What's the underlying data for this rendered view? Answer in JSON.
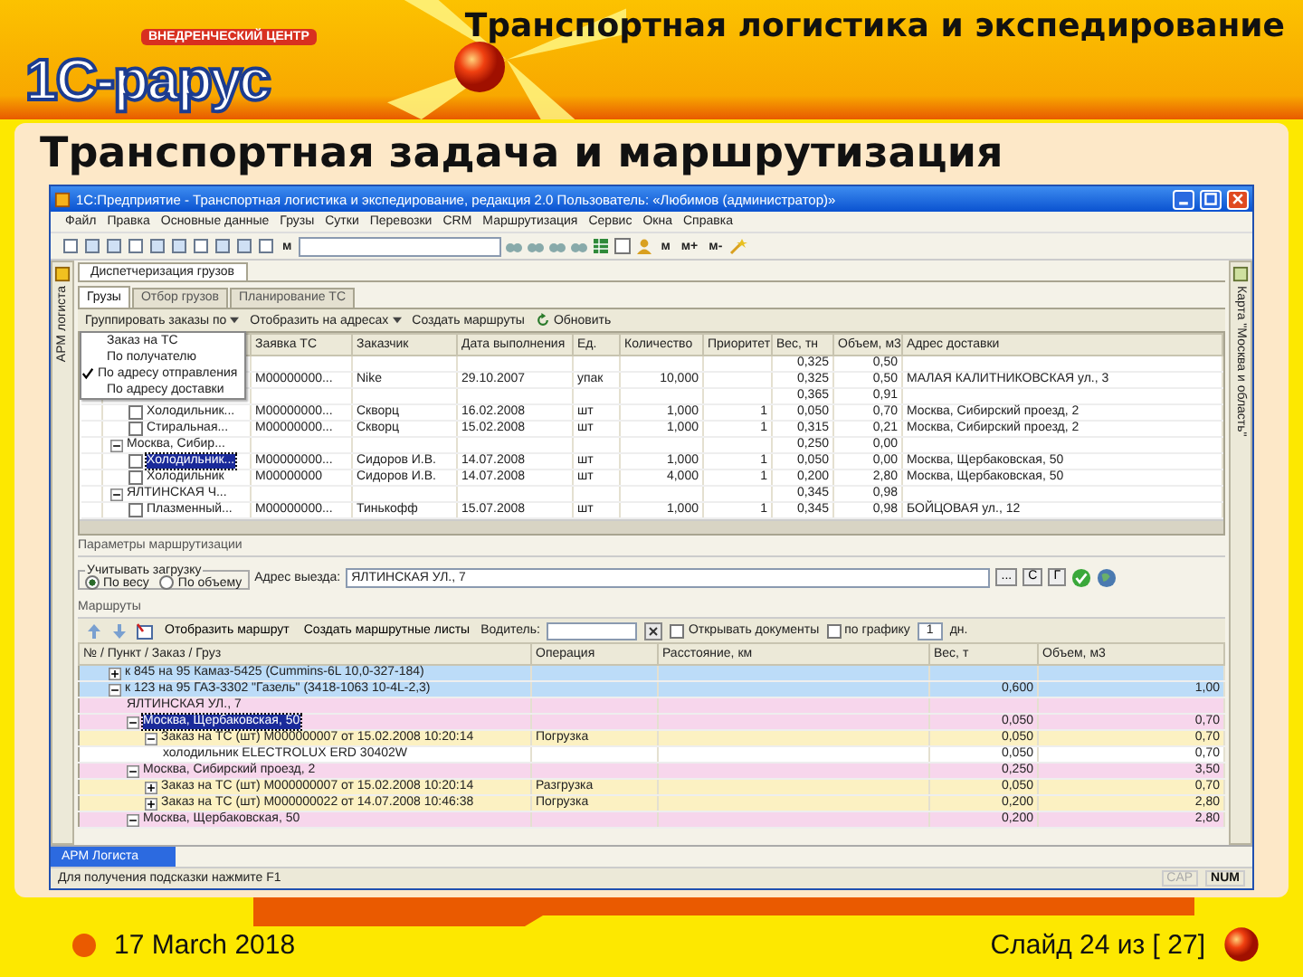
{
  "slide": {
    "logo_badge": "ВНЕДРЕНЧЕСКИЙ ЦЕНТР",
    "logo": "1С-рарус",
    "title": "Транспортная логистика и экспедирование",
    "subtitle": "Транспортная задача и маршрутизация",
    "date": "17 March 2018",
    "page": "Слайд 24 из [ 27]"
  },
  "window": {
    "title": "1С:Предприятие - Транспортная логистика и экспедирование, редакция 2.0   Пользователь: «Любимов (администратор)»",
    "menu": [
      "Файл",
      "Правка",
      "Основные данные",
      "Грузы",
      "Сутки",
      "Перевозки",
      "CRM",
      "Маршрутизация",
      "Сервис",
      "Окна",
      "Справка"
    ],
    "toolbar_labels": [
      "м",
      "м",
      "м+",
      "м-"
    ],
    "left_panel": "АРМ логиста",
    "right_panel": "Карта \"Москва и область\"",
    "doc_tab": "Диспетчеризация грузов",
    "subtabs": [
      {
        "label": "Грузы",
        "selected": true
      },
      {
        "label": "Отбор грузов",
        "selected": false
      },
      {
        "label": "Планирование ТС",
        "selected": false
      }
    ],
    "cargo_toolbar": [
      {
        "label": "Группировать заказы по",
        "dropdown": true,
        "kind": "menu"
      },
      {
        "label": "Отобразить на адресах",
        "dropdown": true,
        "kind": "menu"
      },
      {
        "label": "Создать маршруты",
        "dropdown": false,
        "kind": "plain"
      },
      {
        "label": "Обновить",
        "dropdown": false,
        "kind": "refresh"
      }
    ],
    "group_menu": [
      {
        "label": "Заказ на ТС",
        "checked": false
      },
      {
        "label": "По получателю",
        "checked": false
      },
      {
        "label": "По адресу отправления",
        "checked": true
      },
      {
        "label": "По адресу доставки",
        "checked": false
      }
    ],
    "cargo_table": {
      "columns": [
        "Заявка ТС",
        "Заказчик",
        "Дата выполнения",
        "Ед.",
        "Количество",
        "Приоритет",
        "Вес, тн",
        "Объем, м3",
        "Адрес доставки"
      ],
      "rows": [
        {
          "weight": "0,325",
          "volume": "0,50",
          "children": [
            {
              "order": "М00000000...",
              "customer": "Nike",
              "date": "29.10.2007",
              "unit": "упак",
              "qty": "10,000",
              "weight": "0,325",
              "volume": "0,50",
              "address": "МАЛАЯ КАЛИТНИКОВСКАЯ ул., 3"
            }
          ]
        },
        {
          "weight": "0,365",
          "volume": "0,91",
          "children": [
            {
              "selected": false,
              "checked": false,
              "name": "Холодильник...",
              "order": "М00000000...",
              "customer": "Скворц",
              "date": "16.02.2008",
              "unit": "шт",
              "qty": "1,000",
              "priority": "1",
              "weight": "0,050",
              "volume": "0,70",
              "address": "Москва, Сибирский проезд, 2"
            },
            {
              "selected": false,
              "checked": false,
              "name": "Стиральная...",
              "order": "М00000000...",
              "customer": "Скворц",
              "date": "15.02.2008",
              "unit": "шт",
              "qty": "1,000",
              "priority": "1",
              "weight": "0,315",
              "volume": "0,21",
              "address": "Москва, Сибирский проезд, 2"
            }
          ]
        },
        {
          "selected": false,
          "expanded": true,
          "name": "Москва, Сибир...",
          "weight": "0,250",
          "volume": "0,00",
          "children": [
            {
              "selected": true,
              "checked": false,
              "name": "Холодильник...",
              "order": "М00000000...",
              "customer": "Сидоров И.В.",
              "date": "14.07.2008",
              "unit": "шт",
              "qty": "1,000",
              "priority": "1",
              "weight": "0,050",
              "volume": "0,00",
              "address": "Москва, Щербаковская, 50"
            },
            {
              "selected": false,
              "checked": false,
              "name": "Холодильник",
              "order": "М00000000",
              "customer": "Сидоров И.В.",
              "date": "14.07.2008",
              "unit": "шт",
              "qty": "4,000",
              "priority": "1",
              "weight": "0,200",
              "volume": "2,80",
              "address": "Москва, Щербаковская, 50"
            }
          ]
        },
        {
          "selected": false,
          "expanded": true,
          "name": "ЯЛТИНСКАЯ Ч...",
          "weight": "0,345",
          "volume": "0,98",
          "children": [
            {
              "selected": false,
              "checked": false,
              "name": "Плазменный...",
              "order": "М00000000...",
              "customer": "Тинькофф",
              "date": "15.07.2008",
              "unit": "шт",
              "qty": "1,000",
              "priority": "1",
              "weight": "0,345",
              "volume": "0,98",
              "address": "БОЙЦОВАЯ ул., 12"
            }
          ]
        }
      ]
    },
    "routing": {
      "title": "Параметры маршрутизации",
      "load_group": "Учитывать загрузку",
      "load_options": [
        {
          "label": "По весу",
          "selected": true
        },
        {
          "label": "По объему",
          "selected": false
        }
      ],
      "start_label": "Адрес выезда:",
      "start_value": "ЯЛТИНСКАЯ УЛ., 7",
      "start_buttons": [
        "...",
        "С",
        "Г"
      ]
    },
    "routes": {
      "title": "Маршруты",
      "buttons": [
        "Отобразить маршрут",
        "Создать маршрутные листы"
      ],
      "driver_label": "Водитель:",
      "options": [
        {
          "label": "Открывать документы",
          "checked": false
        },
        {
          "label": "по графику",
          "checked": false
        }
      ],
      "days": "1",
      "days_unit": "дн.",
      "columns": [
        "№ / Пункт / Заказ / Груз",
        "Операция",
        "Расстояние, км",
        "Вес, т",
        "Объем, м3"
      ],
      "rows": [
        {
          "kind": "vehicle",
          "selected": false,
          "expanded": false,
          "text": "к 845 на 95 Камаз-5425 (Cummins-6L 10,0-327-184)"
        },
        {
          "kind": "vehicle",
          "selected": false,
          "expanded": true,
          "text": "к 123 на 95 ГАЗ-3302 \"Газель\" (3418-1063 10-4L-2,3)",
          "weight": "0,600",
          "volume": "1,00",
          "children": [
            {
              "kind": "point",
              "selected": false,
              "text": "ЯЛТИНСКАЯ УЛ., 7"
            },
            {
              "kind": "point",
              "selected": true,
              "expanded": true,
              "text": "Москва, Щербаковская, 50",
              "weight": "0,050",
              "volume": "0,70",
              "children": [
                {
                  "kind": "order",
                  "selected": false,
                  "expanded": true,
                  "text": "Заказ на ТС (шт) М000000007 от 15.02.2008 10:20:14",
                  "operation": "Погрузка",
                  "weight": "0,050",
                  "volume": "0,70",
                  "children": [
                    {
                      "kind": "cargo",
                      "selected": false,
                      "text": "холодильник ELECTROLUX ERD 30402W",
                      "weight": "0,050",
                      "volume": "0,70"
                    }
                  ]
                }
              ]
            },
            {
              "kind": "point",
              "selected": false,
              "expanded": true,
              "text": "Москва, Сибирский проезд, 2",
              "weight": "0,250",
              "volume": "3,50",
              "children": [
                {
                  "kind": "order",
                  "selected": false,
                  "expanded": false,
                  "text": "Заказ на ТС (шт) М000000007 от 15.02.2008 10:20:14",
                  "operation": "Разгрузка",
                  "weight": "0,050",
                  "volume": "0,70"
                },
                {
                  "kind": "order",
                  "selected": false,
                  "expanded": false,
                  "text": "Заказ на ТС (шт) М000000022 от 14.07.2008 10:46:38",
                  "operation": "Погрузка",
                  "weight": "0,200",
                  "volume": "2,80"
                }
              ]
            },
            {
              "kind": "point",
              "selected": false,
              "expanded": true,
              "text": "Москва, Щербаковская, 50",
              "weight": "0,200",
              "volume": "2,80"
            }
          ]
        }
      ]
    },
    "taskbar": "АРМ Логиста",
    "status": {
      "hint": "Для получения подсказки нажмите F1",
      "indicators": [
        {
          "label": "CAP",
          "on": false
        },
        {
          "label": "NUM",
          "on": true
        }
      ]
    }
  }
}
